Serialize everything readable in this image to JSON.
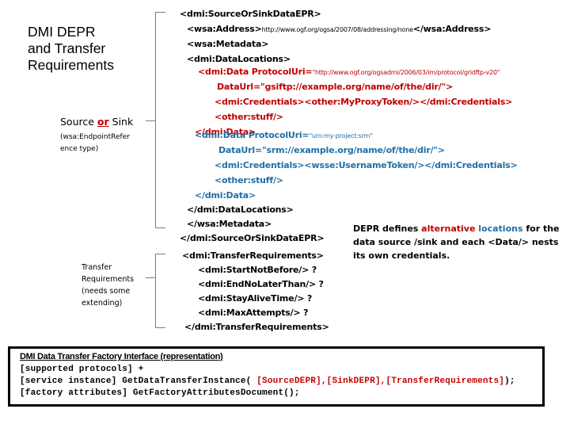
{
  "title": {
    "lines": [
      "DMI DEPR",
      "and Transfer",
      "Requirements"
    ]
  },
  "source_label": {
    "prefix": "Source ",
    "or": "or",
    "suffix": " Sink",
    "sub_line1": "(wsa:EndpointRefer",
    "sub_line2": "ence type)"
  },
  "transfer_label": {
    "lines": [
      "Transfer",
      "Requirements",
      "(needs some",
      "extending)"
    ]
  },
  "epr_xml": {
    "open": "<dmi:SourceOrSinkDataEPR>",
    "address_open": "<wsa:Address>",
    "address_value": "http://www.ogf.org/ogsa/2007/08/addressing/none",
    "address_close": "</wsa:Address>",
    "metadata_open": "<wsa:Metadata>",
    "locations_open": "<dmi:DataLocations>",
    "data1": {
      "open": "<dmi:Data ProtocolUri=",
      "protocol": "\"http://www.ogf.org/ogsadmi/2006/03/im/protocol/gridftp-v20\"",
      "url": "DataUrl=\"gsiftp://example.org/name/of/the/dir/\">",
      "credentials": "<dmi:Credentials><other:MyProxyToken/></dmi:Credentials>",
      "stuff": "<other:stuff/>",
      "close": "</dmi:Data>"
    },
    "data2": {
      "open": "<dmi:Data ProtocolUri=",
      "protocol": "\"urn:my-project:srm\"",
      "url": "DataUrl=\"srm://example.org/name/of/the/dir/\">",
      "credentials": "<dmi:Credentials><wsse:UsernameToken/></dmi:Credentials>",
      "stuff": "<other:stuff/>",
      "close": "</dmi:Data>"
    },
    "locations_close": "</dmi:DataLocations>",
    "metadata_close": "</wsa:Metadata>",
    "close": "</dmi:SourceOrSinkDataEPR>"
  },
  "transfer_xml": {
    "open": "<dmi:TransferRequirements>",
    "items": [
      "<dmi:StartNotBefore/> ?",
      "<dmi:EndNoLaterThan/> ?",
      "<dmi:StayAliveTime/> ?",
      "<dmi:MaxAttempts/> ?"
    ],
    "close": "</dmi:TransferRequirements>"
  },
  "note": {
    "line1_prefix": "DEPR defines ",
    "line1_red": "alternative",
    "line1_blue": " locations",
    "line1_suffix": " for the",
    "line2": "data source /sink and each <Data/> nests",
    "line3": "its own credentials."
  },
  "factory": {
    "heading": "DMI Data Transfer Factory Interface (representation)",
    "line1": "[supported protocols] +",
    "line2_prefix": "[service instance] GetDataTransferInstance( ",
    "line2_args": "[SourceDEPR],[SinkDEPR],[TransferRequirements]",
    "line2_suffix": ");",
    "line3": "[factory attributes] GetFactoryAttributesDocument();"
  },
  "colors": {
    "red": "#c00000",
    "blue": "#1f6fa6",
    "bracket": "#6b8196"
  }
}
